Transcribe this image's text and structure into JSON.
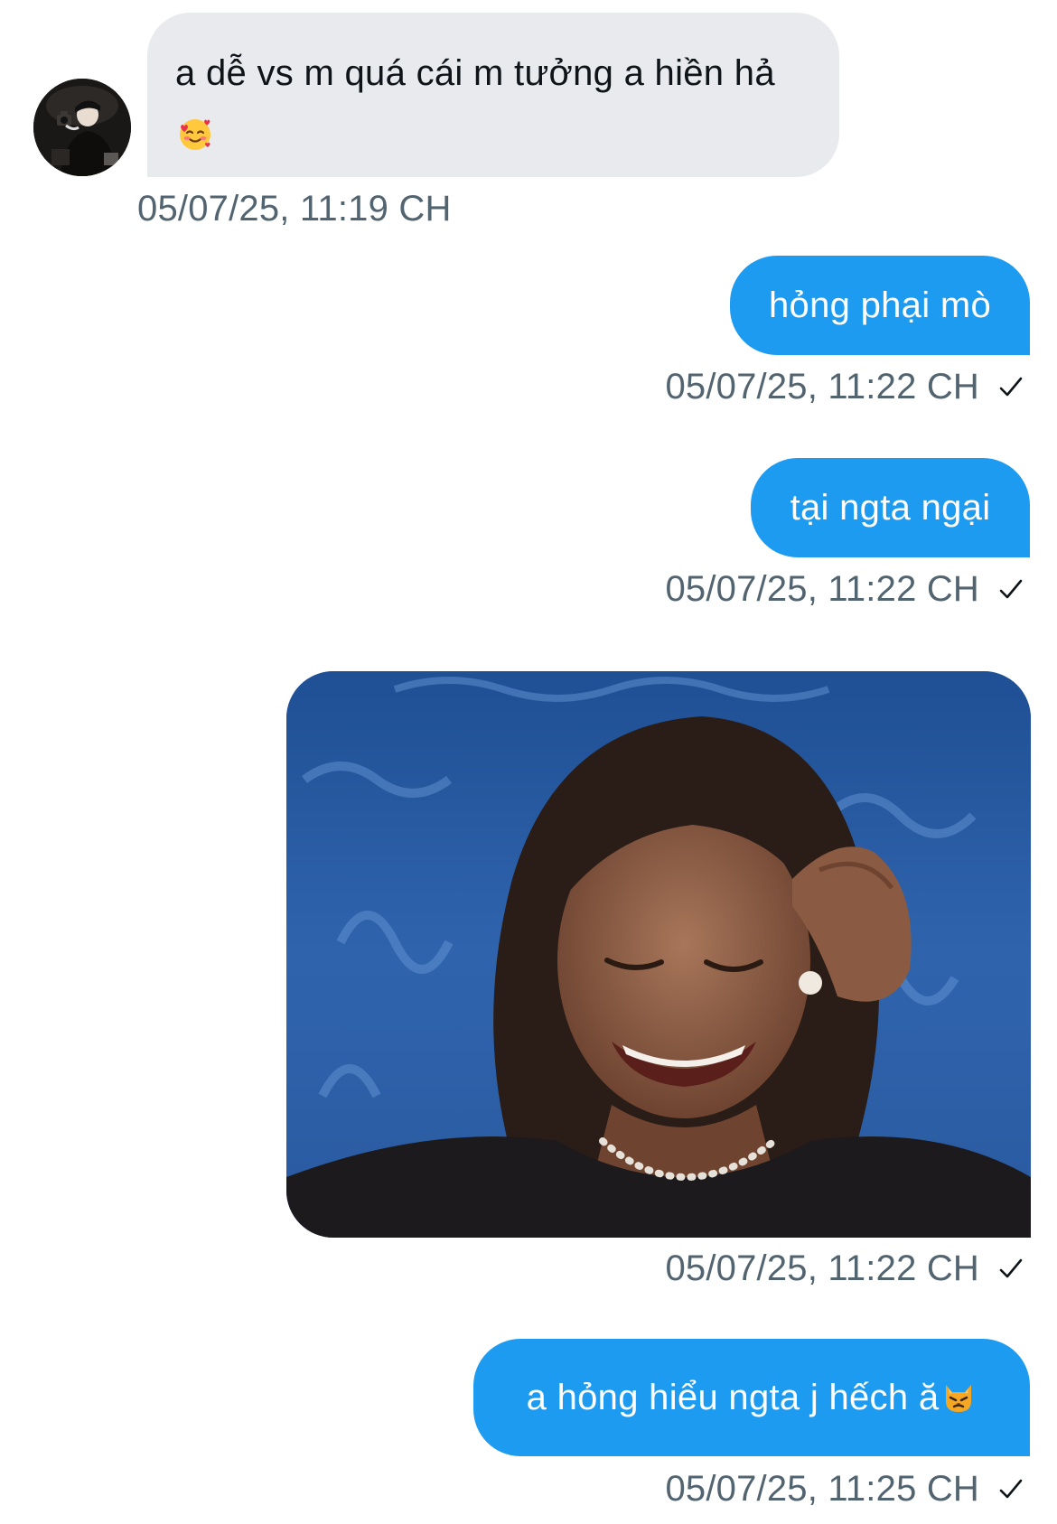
{
  "conversation": {
    "incoming": {
      "avatar_icon": "profile-photo",
      "text": "a dễ vs m quá cái m tưởng a hiền hả",
      "emoji_icon": "smiling-face-with-hearts-emoji",
      "timestamp": "05/07/25, 11:19 CH"
    },
    "outgoing": [
      {
        "text": "hỏng phại mò",
        "timestamp": "05/07/25, 11:22 CH"
      },
      {
        "text": "tại ngta ngại",
        "timestamp": "05/07/25, 11:22 CH"
      },
      {
        "media_icon": "gif-woman-laughing",
        "timestamp": "05/07/25, 11:22 CH"
      },
      {
        "text": "a hỏng hiểu ngta j hếch ă",
        "emoji_icon": "pouting-cat-emoji",
        "timestamp": "05/07/25, 11:25 CH"
      }
    ],
    "status_icon": "sent-check-icon"
  },
  "colors": {
    "outgoing_bubble": "#1d9bf0",
    "incoming_bubble": "#e8eaed",
    "timestamp": "#536471",
    "background": "#ffffff"
  }
}
